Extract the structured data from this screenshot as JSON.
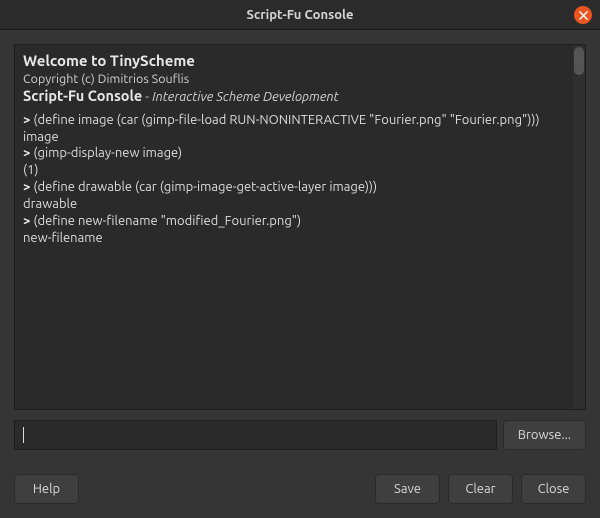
{
  "titlebar": {
    "title": "Script-Fu Console"
  },
  "console": {
    "welcome_title": "Welcome to TinyScheme",
    "copyright": "Copyright (c) Dimitrios Souflis",
    "subtitle": "Script-Fu Console",
    "subsub": " - Interactive Scheme Development",
    "entries": [
      {
        "prompt": "> ",
        "cmd": "(define image (car (gimp-file-load RUN-NONINTERACTIVE \"Fourier.png\" \"Fourier.png\")))",
        "result": "image"
      },
      {
        "prompt": "> ",
        "cmd": "(gimp-display-new image)",
        "result": "(1)"
      },
      {
        "prompt": "> ",
        "cmd": "(define drawable (car (gimp-image-get-active-layer image)))",
        "result": "drawable"
      },
      {
        "prompt": "> ",
        "cmd": "(define new-filename \"modified_Fourier.png\")",
        "result": "new-filename"
      }
    ]
  },
  "input": {
    "value": "",
    "browse_label": "Browse..."
  },
  "buttons": {
    "help": "Help",
    "save": "Save",
    "clear": "Clear",
    "close": "Close"
  }
}
